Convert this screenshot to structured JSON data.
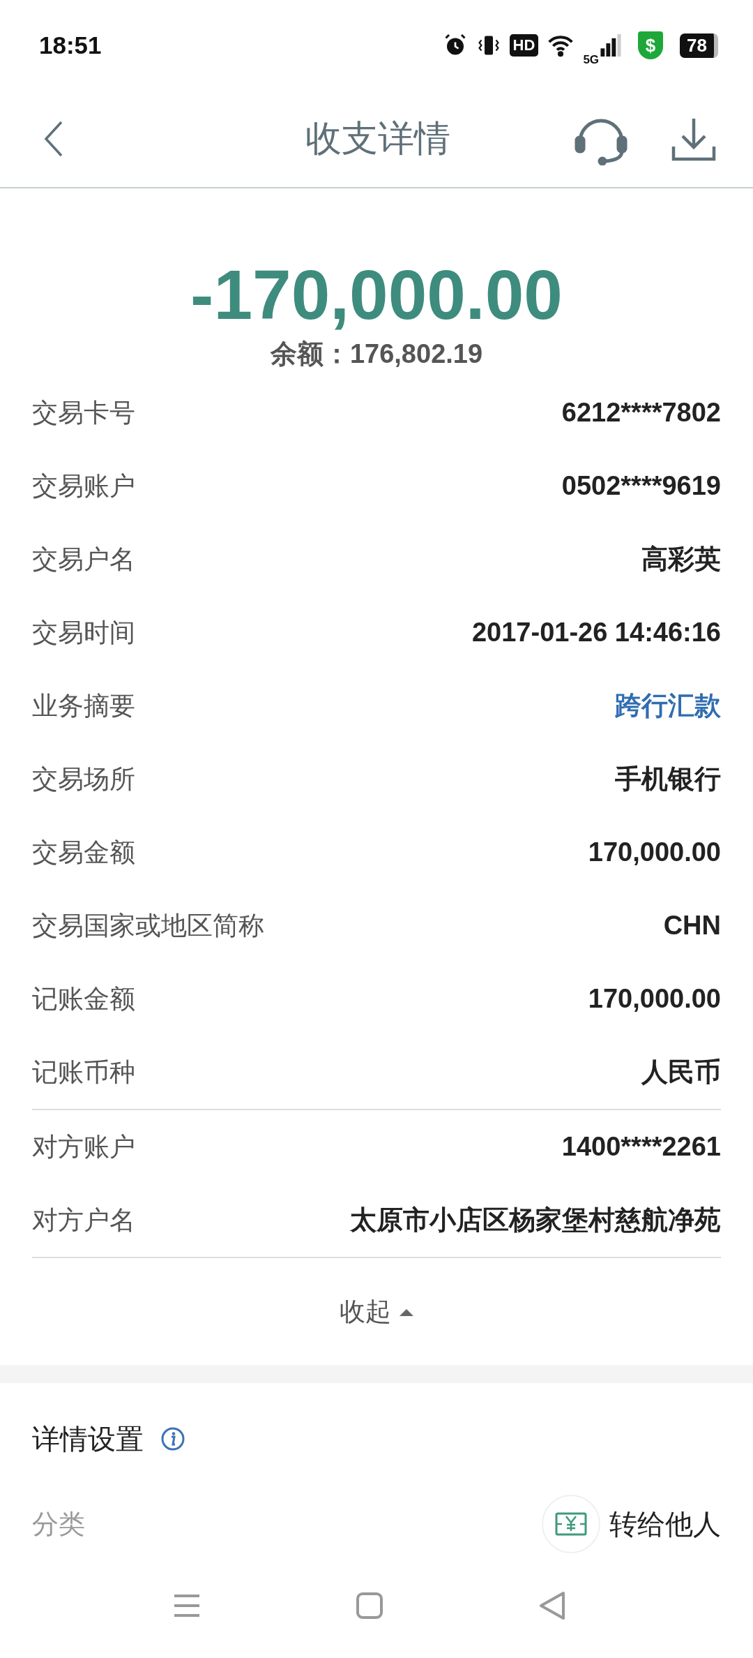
{
  "status_bar": {
    "time": "18:51",
    "hd_label": "HD",
    "network": "5G",
    "shield_glyph": "$",
    "battery": "78"
  },
  "header": {
    "title": "收支详情"
  },
  "summary": {
    "amount": "-170,000.00",
    "balance": "余额：176,802.19"
  },
  "groups": [
    {
      "rows": [
        {
          "label": "交易卡号",
          "value": "6212****7802",
          "kind": "text"
        },
        {
          "label": "交易账户",
          "value": "0502****9619",
          "kind": "text"
        },
        {
          "label": "交易户名",
          "value": "高彩英",
          "kind": "text"
        },
        {
          "label": "交易时间",
          "value": "2017-01-26 14:46:16",
          "kind": "text"
        },
        {
          "label": "业务摘要",
          "value": "跨行汇款",
          "kind": "link"
        },
        {
          "label": "交易场所",
          "value": "手机银行",
          "kind": "text"
        },
        {
          "label": "交易金额",
          "value": "170,000.00",
          "kind": "text"
        },
        {
          "label": "交易国家或地区简称",
          "value": "CHN",
          "kind": "text"
        },
        {
          "label": "记账金额",
          "value": "170,000.00",
          "kind": "text"
        },
        {
          "label": "记账币种",
          "value": "人民币",
          "kind": "text"
        }
      ]
    },
    {
      "rows": [
        {
          "label": "对方账户",
          "value": "1400****2261",
          "kind": "text"
        },
        {
          "label": "对方户名",
          "value": "太原市小店区杨家堡村慈航净苑",
          "kind": "text"
        }
      ]
    }
  ],
  "collapse": {
    "label": "收起",
    "expanded": true
  },
  "settings": {
    "title": "详情设置",
    "category_label": "分类",
    "category_value": "转给他人"
  }
}
